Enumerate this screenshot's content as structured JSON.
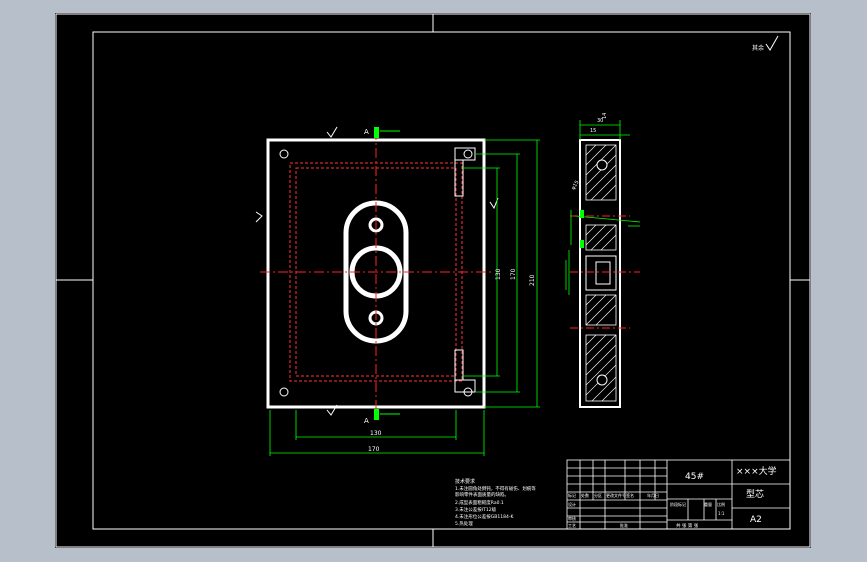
{
  "title_block": {
    "material": "45#",
    "university": "×××大学",
    "part_name": "型芯",
    "sheet_size": "A2",
    "scale_label": "比例",
    "scale_value": "1:1",
    "header_row": [
      "标记",
      "处数",
      "分区",
      "更改文件号",
      "签名",
      "年月日"
    ],
    "row_labels": [
      "设计",
      "审核",
      "工艺"
    ],
    "stage_labels": [
      "阶段标记",
      "重量",
      "比例"
    ],
    "sheet_row": "共 张 第 张",
    "approve_label": "批准"
  },
  "dimensions": {
    "width_inner": "130",
    "width_total": "170",
    "width_tol": "+0.1\n0",
    "height_inner": "130",
    "height_mid": "170",
    "height_total": "210",
    "side_top": "30",
    "side_top2": "15",
    "side_dia": "φ15",
    "side_top_small": "14"
  },
  "section_labels": {
    "a_top": "A",
    "a_bottom": "A",
    "roughness_note": "其余"
  },
  "notes": {
    "heading": "技术要求",
    "lines": [
      "1.未注圆角处倒钝，不得有碰伤、划痕等",
      "  影响零件表面质量的缺陷。",
      "2.成型表面粗糙度Ra0.1",
      "3.未注公差按IT12级",
      "4.未注形位公差按GB1184-K",
      "5.热处理"
    ]
  },
  "colors": {
    "outline": "#ffffff",
    "dimension": "#00ff00",
    "centerline": "#ff0000",
    "hidden": "#ff0000",
    "hatch": "#ffffff",
    "highlight": "#00ff00"
  }
}
